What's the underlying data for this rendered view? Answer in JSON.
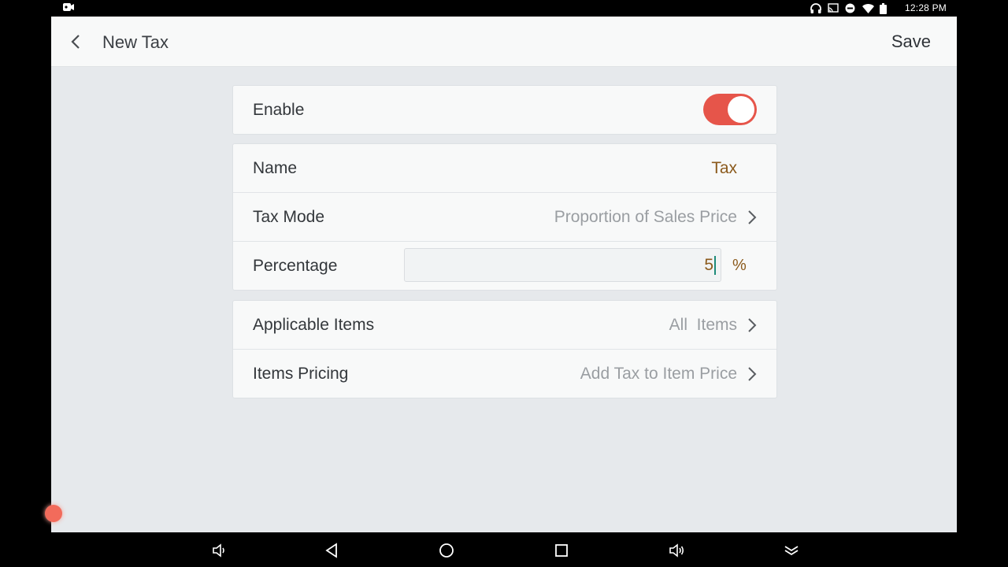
{
  "status_bar": {
    "time": "12:28 PM",
    "icons": [
      "video-record-icon",
      "headphones-icon",
      "cast-icon",
      "do-not-disturb-icon",
      "wifi-icon",
      "battery-icon"
    ]
  },
  "header": {
    "title": "New Tax",
    "save_label": "Save",
    "back_icon": "chevron-left-icon"
  },
  "colors": {
    "accent_toggle": "#e6554a",
    "value_brown": "#8b5a1c",
    "background": "#e6e9ec"
  },
  "enable_card": {
    "label": "Enable",
    "enabled": true
  },
  "details_card": {
    "name_label": "Name",
    "name_value": "Tax",
    "tax_mode_label": "Tax Mode",
    "tax_mode_value": "Proportion of Sales Price",
    "percentage_label": "Percentage",
    "percentage_value": "5",
    "percentage_unit": "%"
  },
  "items_card": {
    "applicable_label": "Applicable Items",
    "applicable_value": "All  Items",
    "pricing_label": "Items Pricing",
    "pricing_value": "Add Tax to Item Price"
  },
  "nav_bar": {
    "icons": [
      "volume-down-icon",
      "back-triangle-icon",
      "home-circle-icon",
      "recents-square-icon",
      "volume-up-icon",
      "expand-down-icon"
    ]
  }
}
